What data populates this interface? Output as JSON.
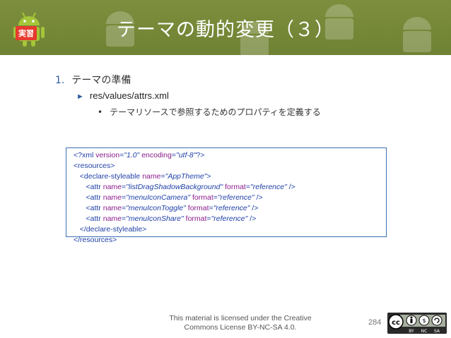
{
  "header": {
    "title": "テーマの動的変更（３）",
    "badge": "実習"
  },
  "list": {
    "level1": {
      "number": "1.",
      "text": "テーマの準備"
    },
    "level2": {
      "bullet": "►",
      "text": "res/values/attrs.xml"
    },
    "level3": {
      "bullet": "•",
      "text": "テーマリソースで参照するためのプロパティを定義する"
    }
  },
  "code": {
    "lines": [
      [
        {
          "t": "tag",
          "v": "<?xml "
        },
        {
          "t": "attr",
          "v": "version"
        },
        {
          "t": "tag",
          "v": "="
        },
        {
          "t": "val",
          "v": "\"1.0\""
        },
        {
          "t": "tag",
          "v": " "
        },
        {
          "t": "attr",
          "v": "encoding"
        },
        {
          "t": "tag",
          "v": "="
        },
        {
          "t": "val",
          "v": "\"utf-8\""
        },
        {
          "t": "tag",
          "v": "?>"
        }
      ],
      [
        {
          "t": "tag",
          "v": "<resources>"
        }
      ],
      [
        {
          "t": "tag",
          "v": "   <declare-styleable "
        },
        {
          "t": "attr",
          "v": "name"
        },
        {
          "t": "tag",
          "v": "="
        },
        {
          "t": "val",
          "v": "\"AppTheme\""
        },
        {
          "t": "tag",
          "v": ">"
        }
      ],
      [
        {
          "t": "tag",
          "v": "      <attr "
        },
        {
          "t": "attr",
          "v": "name"
        },
        {
          "t": "tag",
          "v": "="
        },
        {
          "t": "val",
          "v": "\"listDragShadowBackground\""
        },
        {
          "t": "tag",
          "v": " "
        },
        {
          "t": "attr",
          "v": "format"
        },
        {
          "t": "tag",
          "v": "="
        },
        {
          "t": "val",
          "v": "\"reference\""
        },
        {
          "t": "tag",
          "v": " />"
        }
      ],
      [
        {
          "t": "tag",
          "v": "      <attr "
        },
        {
          "t": "attr",
          "v": "name"
        },
        {
          "t": "tag",
          "v": "="
        },
        {
          "t": "val",
          "v": "\"menuIconCamera\""
        },
        {
          "t": "tag",
          "v": " "
        },
        {
          "t": "attr",
          "v": "format"
        },
        {
          "t": "tag",
          "v": "="
        },
        {
          "t": "val",
          "v": "\"reference\""
        },
        {
          "t": "tag",
          "v": " />"
        }
      ],
      [
        {
          "t": "tag",
          "v": "      <attr "
        },
        {
          "t": "attr",
          "v": "name"
        },
        {
          "t": "tag",
          "v": "="
        },
        {
          "t": "val",
          "v": "\"menuIconToggle\""
        },
        {
          "t": "tag",
          "v": " "
        },
        {
          "t": "attr",
          "v": "format"
        },
        {
          "t": "tag",
          "v": "="
        },
        {
          "t": "val",
          "v": "\"reference\""
        },
        {
          "t": "tag",
          "v": " />"
        }
      ],
      [
        {
          "t": "tag",
          "v": "      <attr "
        },
        {
          "t": "attr",
          "v": "name"
        },
        {
          "t": "tag",
          "v": "="
        },
        {
          "t": "val",
          "v": "\"menuIconShare\""
        },
        {
          "t": "tag",
          "v": " "
        },
        {
          "t": "attr",
          "v": "format"
        },
        {
          "t": "tag",
          "v": "="
        },
        {
          "t": "val",
          "v": "\"reference\""
        },
        {
          "t": "tag",
          "v": " />"
        }
      ],
      [
        {
          "t": "tag",
          "v": "   </declare-styleable>"
        }
      ],
      [
        {
          "t": "tag",
          "v": "</resources>"
        }
      ]
    ]
  },
  "footer": {
    "license_line1": "This material is licensed under the Creative",
    "license_line2": "Commons License BY-NC-SA 4.0.",
    "page_number": "284",
    "cc_label_1": "BY",
    "cc_label_2": "NC",
    "cc_label_3": "SA"
  },
  "colors": {
    "header_bg": "#768a38",
    "accent": "#2f5b9e",
    "badge": "#e63b2e"
  }
}
